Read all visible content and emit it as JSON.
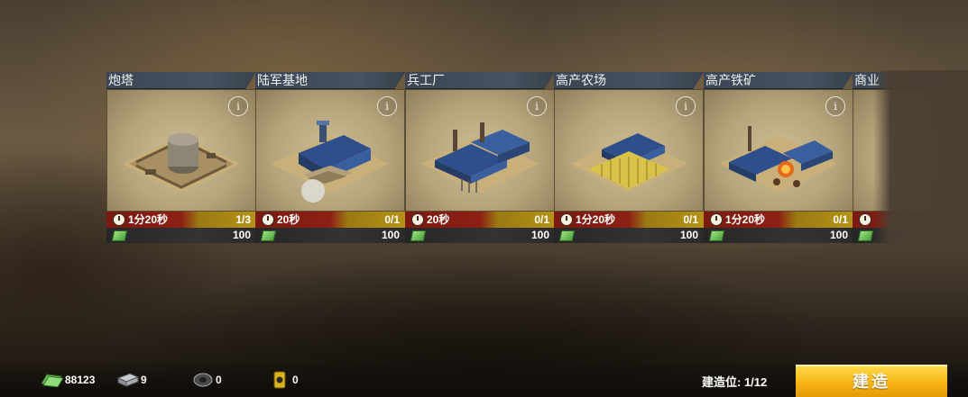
{
  "buildings": [
    {
      "name": "炮塔",
      "time": "1分20秒",
      "count": "1/3",
      "cost": "100"
    },
    {
      "name": "陆军基地",
      "time": "20秒",
      "count": "0/1",
      "cost": "100"
    },
    {
      "name": "兵工厂",
      "time": "20秒",
      "count": "0/1",
      "cost": "100"
    },
    {
      "name": "高产农场",
      "time": "1分20秒",
      "count": "0/1",
      "cost": "100"
    },
    {
      "name": "高产铁矿",
      "time": "1分20秒",
      "count": "0/1",
      "cost": "100"
    },
    {
      "name": "商业",
      "time": "",
      "count": "",
      "cost": ""
    }
  ],
  "info_label": "i",
  "resources": {
    "money": "88123",
    "steel": "9",
    "rubber": "0",
    "oil": "0"
  },
  "build_slots_label": "建造位: 1/12",
  "build_button": "建造",
  "colors": {
    "build_button": "#f6b413",
    "time_bar": "#8d2014",
    "count_bar": "#b59317"
  },
  "icons": [
    "clock-icon",
    "money-icon",
    "steel-icon",
    "rubber-icon",
    "oil-icon",
    "info-icon"
  ]
}
